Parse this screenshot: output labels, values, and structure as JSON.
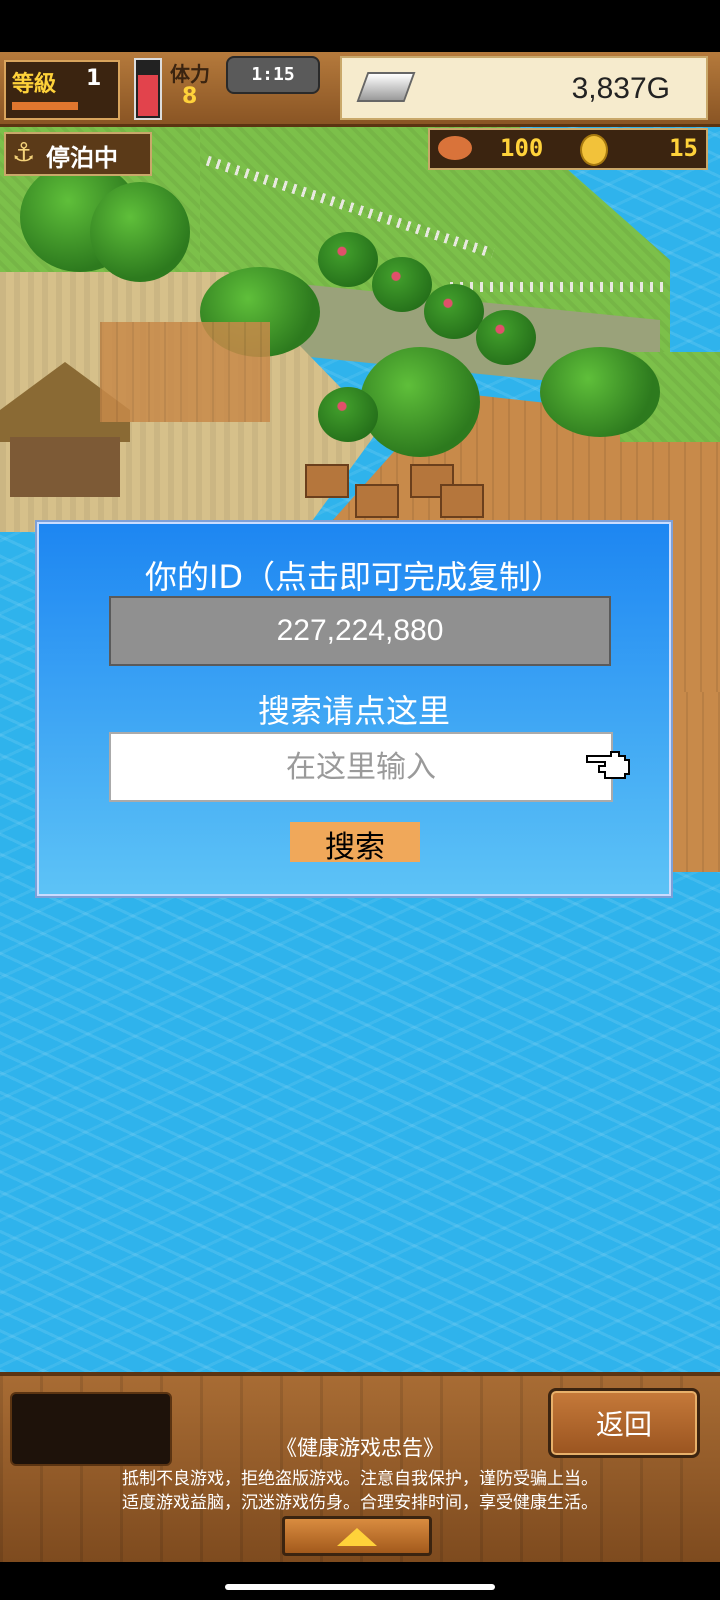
{
  "hud": {
    "level_label": "等級",
    "level_value": "1",
    "stamina_label": "体力",
    "stamina_value": "8",
    "stamina_fill_fraction": 0.75,
    "timer": "1:15",
    "gold": "3,837G",
    "food": "100",
    "medals": "15",
    "anchor_status": "停泊中"
  },
  "dialog": {
    "title": "你的ID（点击即可完成复制）",
    "user_id": "227,224,880",
    "search_hint": "搜索请点这里",
    "input_placeholder": "在这里输入",
    "input_value": "",
    "search_button": "搜索"
  },
  "bottom": {
    "back_button": "返回",
    "health_title": "《健康游戏忠告》",
    "health_line1": "抵制不良游戏，拒绝盗版游戏。注意自我保护，谨防受骗上当。",
    "health_line2": "适度游戏益脑，沉迷游戏伤身。合理安排时间，享受健康生活。"
  },
  "colors": {
    "dialog_top": "#1d86f2",
    "dialog_bottom": "#5dc3f6",
    "search_button": "#f0a85a",
    "sea": "#2fb3ec",
    "hud_wood": "#b57a3c"
  },
  "icons": [
    "silver-bar-icon",
    "meat-icon",
    "medal-coin-icon",
    "anchor-icon",
    "pointing-hand-icon",
    "up-arrow-icon"
  ]
}
